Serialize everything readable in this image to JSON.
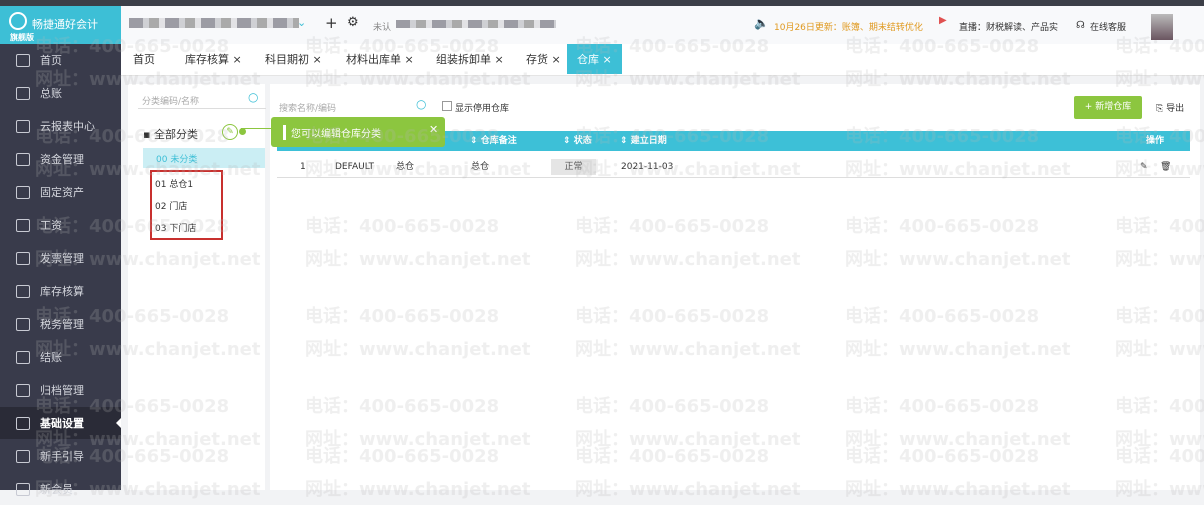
{
  "app": {
    "name": "畅捷通好会计",
    "edition": "旗舰版"
  },
  "header": {
    "notice": "10月26日更新：账簿、期末结转优化",
    "live": "直播：财税解读、产品实",
    "service": "在线客服",
    "unconfirmed": "未认"
  },
  "tabs": [
    {
      "label": "首页"
    },
    {
      "label": "库存核算"
    },
    {
      "label": "科目期初"
    },
    {
      "label": "材料出库单"
    },
    {
      "label": "组装拆卸单"
    },
    {
      "label": "存货"
    },
    {
      "label": "仓库"
    }
  ],
  "sidebar": {
    "items": [
      {
        "label": "首页",
        "icon": "home-icon"
      },
      {
        "label": "总账",
        "icon": "ledger-icon"
      },
      {
        "label": "云报表中心",
        "icon": "report-icon"
      },
      {
        "label": "资金管理",
        "icon": "fund-icon"
      },
      {
        "label": "固定资产",
        "icon": "asset-icon"
      },
      {
        "label": "工资",
        "icon": "salary-icon"
      },
      {
        "label": "发票管理",
        "icon": "invoice-icon"
      },
      {
        "label": "库存核算",
        "icon": "inventory-icon"
      },
      {
        "label": "税务管理",
        "icon": "tax-icon"
      },
      {
        "label": "结账",
        "icon": "close-account-icon"
      },
      {
        "label": "归档管理",
        "icon": "archive-icon"
      },
      {
        "label": "基础设置",
        "icon": "gear-icon"
      },
      {
        "label": "新手引导",
        "icon": "guide-icon"
      },
      {
        "label": "新会员",
        "icon": "member-icon"
      }
    ]
  },
  "category": {
    "search_placeholder": "分类编码/名称",
    "all": "全部分类",
    "items": [
      "00 未分类",
      "01 总仓1",
      "02 门店",
      "03 下门店"
    ]
  },
  "tooltip": "您可以编辑仓库分类",
  "toolbar": {
    "search_placeholder": "搜索名称/编码",
    "show_disabled": "显示停用仓库",
    "add": "+ 新增仓库",
    "export": "导出"
  },
  "table": {
    "headers": [
      "仓库备注",
      "状态",
      "建立日期",
      "操作"
    ],
    "rows": [
      {
        "index": "1",
        "code": "DEFAULT",
        "name": "总仓",
        "remark": "总仓",
        "status": "正常",
        "date": "2021-11-03"
      }
    ]
  },
  "watermark": {
    "phone": "电话：400-665-0028",
    "site": "网址：www.chanjet.net"
  }
}
